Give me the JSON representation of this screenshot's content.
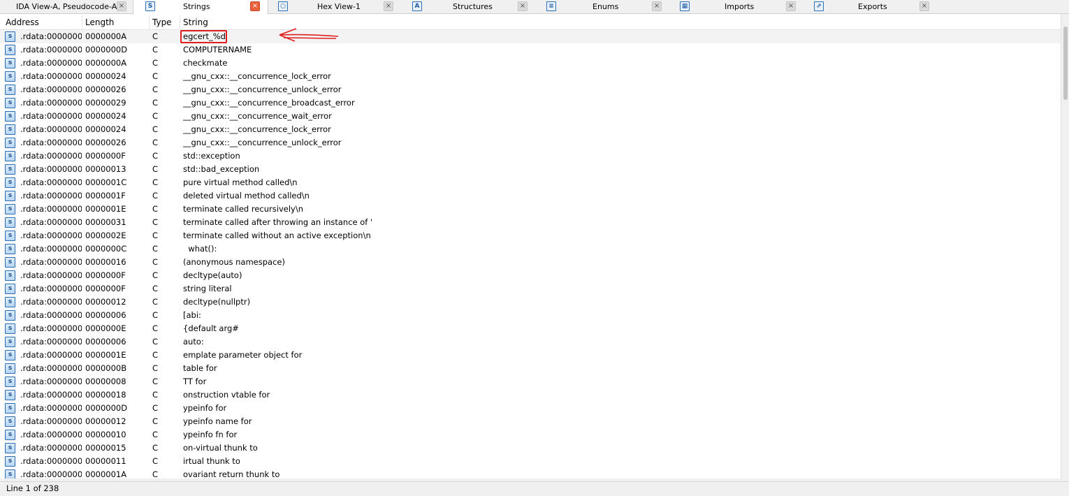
{
  "tabs": [
    {
      "label": "IDA View-A, Pseudocode-A",
      "icon": "",
      "close": "×",
      "active": false
    },
    {
      "label": "Strings",
      "icon": "S",
      "close": "×",
      "active": true
    },
    {
      "label": "Hex View-1",
      "icon": "○",
      "close": "×",
      "active": false
    },
    {
      "label": "Structures",
      "icon": "A",
      "close": "×",
      "active": false
    },
    {
      "label": "Enums",
      "icon": "≡",
      "close": "×",
      "active": false
    },
    {
      "label": "Imports",
      "icon": "▦",
      "close": "×",
      "active": false
    },
    {
      "label": "Exports",
      "icon": "⇗",
      "close": "×",
      "active": false
    }
  ],
  "columns": {
    "address": "Address",
    "length": "Length",
    "type": "Type",
    "string": "String"
  },
  "row_icon": "s",
  "rows": [
    {
      "address": ".rdata:0000000...",
      "length": "0000000A",
      "type": "C",
      "string": "egcert_%d"
    },
    {
      "address": ".rdata:0000000...",
      "length": "0000000D",
      "type": "C",
      "string": "COMPUTERNAME"
    },
    {
      "address": ".rdata:0000000...",
      "length": "0000000A",
      "type": "C",
      "string": "checkmate"
    },
    {
      "address": ".rdata:0000000...",
      "length": "00000024",
      "type": "C",
      "string": "__gnu_cxx::__concurrence_lock_error"
    },
    {
      "address": ".rdata:0000000...",
      "length": "00000026",
      "type": "C",
      "string": "__gnu_cxx::__concurrence_unlock_error"
    },
    {
      "address": ".rdata:0000000...",
      "length": "00000029",
      "type": "C",
      "string": "__gnu_cxx::__concurrence_broadcast_error"
    },
    {
      "address": ".rdata:0000000...",
      "length": "00000024",
      "type": "C",
      "string": "__gnu_cxx::__concurrence_wait_error"
    },
    {
      "address": ".rdata:0000000...",
      "length": "00000024",
      "type": "C",
      "string": "__gnu_cxx::__concurrence_lock_error"
    },
    {
      "address": ".rdata:0000000...",
      "length": "00000026",
      "type": "C",
      "string": "__gnu_cxx::__concurrence_unlock_error"
    },
    {
      "address": ".rdata:0000000...",
      "length": "0000000F",
      "type": "C",
      "string": "std::exception"
    },
    {
      "address": ".rdata:0000000...",
      "length": "00000013",
      "type": "C",
      "string": "std::bad_exception"
    },
    {
      "address": ".rdata:0000000...",
      "length": "0000001C",
      "type": "C",
      "string": "pure virtual method called\\n"
    },
    {
      "address": ".rdata:0000000...",
      "length": "0000001F",
      "type": "C",
      "string": "deleted virtual method called\\n"
    },
    {
      "address": ".rdata:0000000...",
      "length": "0000001E",
      "type": "C",
      "string": "terminate called recursively\\n"
    },
    {
      "address": ".rdata:0000000...",
      "length": "00000031",
      "type": "C",
      "string": "terminate called after throwing an instance of '"
    },
    {
      "address": ".rdata:0000000...",
      "length": "0000002E",
      "type": "C",
      "string": "terminate called without an active exception\\n"
    },
    {
      "address": ".rdata:0000000...",
      "length": "0000000C",
      "type": "C",
      "string": "  what():"
    },
    {
      "address": ".rdata:0000000...",
      "length": "00000016",
      "type": "C",
      "string": "(anonymous namespace)"
    },
    {
      "address": ".rdata:0000000...",
      "length": "0000000F",
      "type": "C",
      "string": "decltype(auto)"
    },
    {
      "address": ".rdata:0000000...",
      "length": "0000000F",
      "type": "C",
      "string": "string literal"
    },
    {
      "address": ".rdata:0000000...",
      "length": "00000012",
      "type": "C",
      "string": "decltype(nullptr)"
    },
    {
      "address": ".rdata:0000000...",
      "length": "00000006",
      "type": "C",
      "string": "[abi:"
    },
    {
      "address": ".rdata:0000000...",
      "length": "0000000E",
      "type": "C",
      "string": "{default arg#"
    },
    {
      "address": ".rdata:0000000...",
      "length": "00000006",
      "type": "C",
      "string": "auto:"
    },
    {
      "address": ".rdata:0000000...",
      "length": "0000001E",
      "type": "C",
      "string": "emplate parameter object for"
    },
    {
      "address": ".rdata:0000000...",
      "length": "0000000B",
      "type": "C",
      "string": "table for"
    },
    {
      "address": ".rdata:0000000...",
      "length": "00000008",
      "type": "C",
      "string": "TT for"
    },
    {
      "address": ".rdata:0000000...",
      "length": "00000018",
      "type": "C",
      "string": "onstruction vtable for"
    },
    {
      "address": ".rdata:0000000...",
      "length": "0000000D",
      "type": "C",
      "string": "ypeinfo for"
    },
    {
      "address": ".rdata:0000000...",
      "length": "00000012",
      "type": "C",
      "string": "ypeinfo name for"
    },
    {
      "address": ".rdata:0000000...",
      "length": "00000010",
      "type": "C",
      "string": "ypeinfo fn for"
    },
    {
      "address": ".rdata:0000000...",
      "length": "00000015",
      "type": "C",
      "string": "on-virtual thunk to"
    },
    {
      "address": ".rdata:0000000...",
      "length": "00000011",
      "type": "C",
      "string": "irtual thunk to"
    },
    {
      "address": ".rdata:0000000...",
      "length": "0000001A",
      "type": "C",
      "string": "ovariant return thunk to"
    }
  ],
  "status": {
    "text": "Line 1 of 238"
  },
  "colors": {
    "annotation": "#e01e1e",
    "active_close": "#e8613a",
    "icon_blue": "#2a6cb4"
  }
}
